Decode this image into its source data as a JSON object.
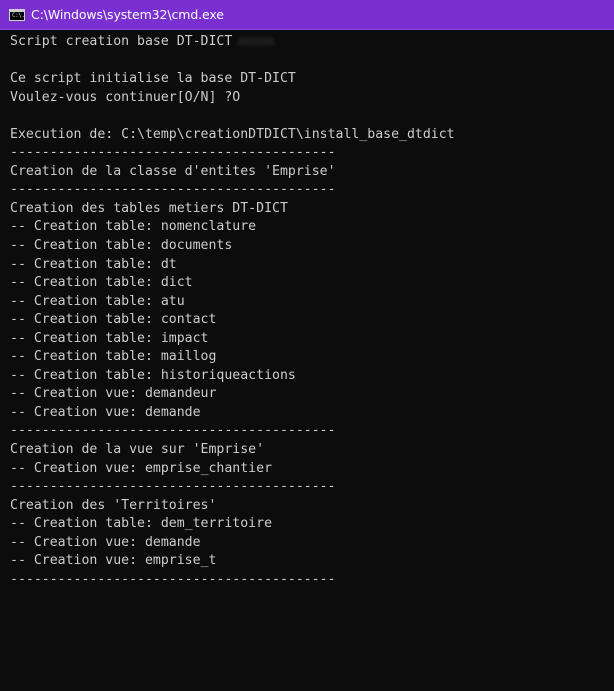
{
  "window": {
    "title": "C:\\Windows\\system32\\cmd.exe",
    "icon_name": "cmd-console-icon",
    "icon_text": "C:\\.",
    "titlebar_color": "#7a2fd1",
    "background_color": "#0c0c0c",
    "text_color": "#cccccc"
  },
  "console": {
    "lines": [
      "Script creation base DT-DICT",
      "",
      "Ce script initialise la base DT-DICT",
      "Voulez-vous continuer[O/N] ?O",
      "",
      "Execution de: C:\\temp\\creationDTDICT\\install_base_dtdict",
      "-----------------------------------------",
      "Creation de la classe d'entites 'Emprise'",
      "-----------------------------------------",
      "Creation des tables metiers DT-DICT",
      "-- Creation table: nomenclature",
      "-- Creation table: documents",
      "-- Creation table: dt",
      "-- Creation table: dict",
      "-- Creation table: atu",
      "-- Creation table: contact",
      "-- Creation table: impact",
      "-- Creation table: maillog",
      "-- Creation table: historiqueactions",
      "-- Creation vue: demandeur",
      "-- Creation vue: demande",
      "-----------------------------------------",
      "Creation de la vue sur 'Emprise'",
      "-- Creation vue: emprise_chantier",
      "-----------------------------------------",
      "Creation des 'Territoires'",
      "-- Creation table: dem_territoire",
      "-- Creation vue: demande",
      "-- Creation vue: emprise_t",
      "-----------------------------------------"
    ]
  }
}
